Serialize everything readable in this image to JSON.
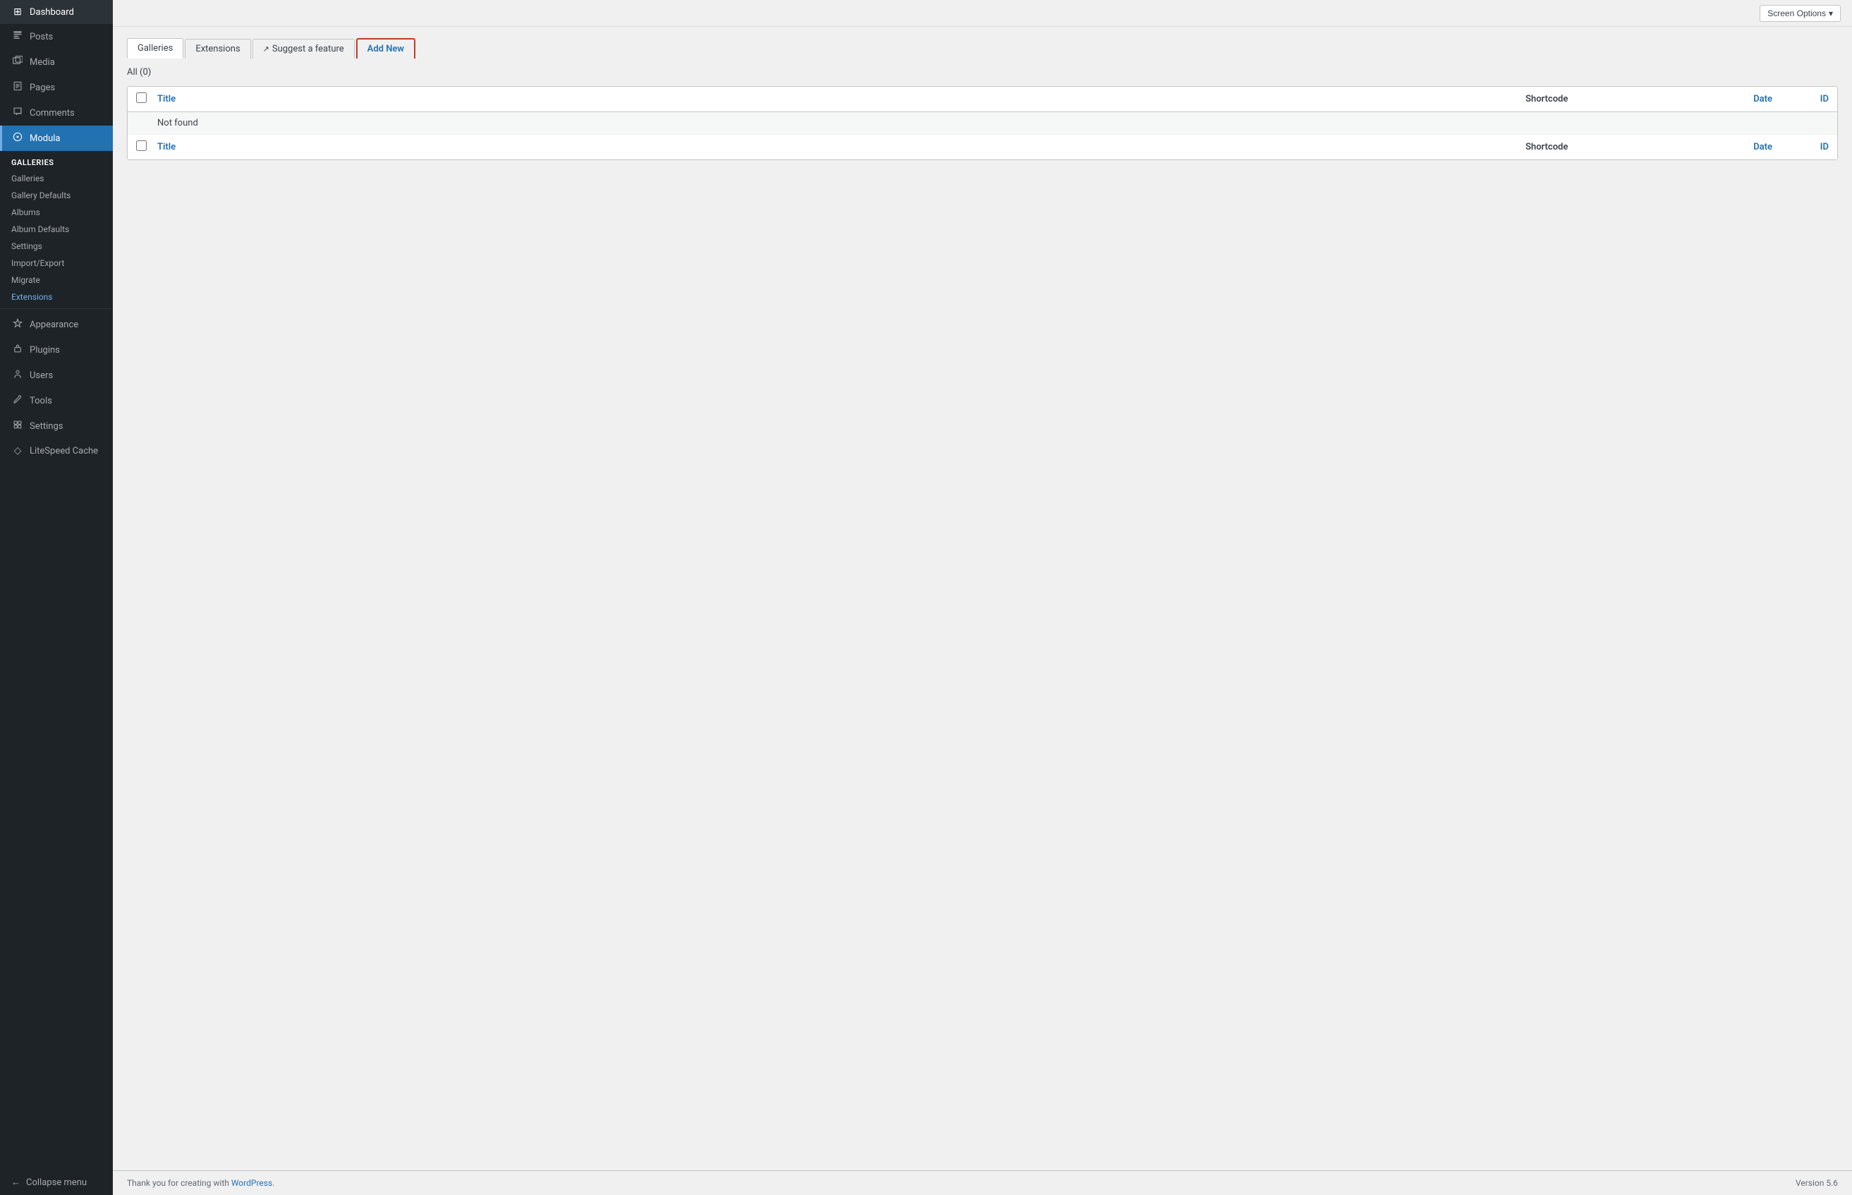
{
  "sidebar": {
    "items": [
      {
        "id": "dashboard",
        "label": "Dashboard",
        "icon": "⊞"
      },
      {
        "id": "posts",
        "label": "Posts",
        "icon": "📝"
      },
      {
        "id": "media",
        "label": "Media",
        "icon": "🖼"
      },
      {
        "id": "pages",
        "label": "Pages",
        "icon": "📄"
      },
      {
        "id": "comments",
        "label": "Comments",
        "icon": "💬"
      },
      {
        "id": "modula",
        "label": "Modula",
        "icon": "⚙"
      }
    ],
    "modula_section": "Galleries",
    "modula_sub": [
      {
        "id": "galleries",
        "label": "Galleries",
        "active": true
      },
      {
        "id": "gallery-defaults",
        "label": "Gallery Defaults"
      },
      {
        "id": "albums",
        "label": "Albums"
      },
      {
        "id": "album-defaults",
        "label": "Album Defaults"
      },
      {
        "id": "settings",
        "label": "Settings"
      },
      {
        "id": "import-export",
        "label": "Import/Export"
      },
      {
        "id": "migrate",
        "label": "Migrate"
      },
      {
        "id": "extensions",
        "label": "Extensions",
        "highlight": true
      }
    ],
    "bottom_items": [
      {
        "id": "appearance",
        "label": "Appearance",
        "icon": "🎨"
      },
      {
        "id": "plugins",
        "label": "Plugins",
        "icon": "🔌"
      },
      {
        "id": "users",
        "label": "Users",
        "icon": "👤"
      },
      {
        "id": "tools",
        "label": "Tools",
        "icon": "🔧"
      },
      {
        "id": "settings",
        "label": "Settings",
        "icon": "⚙"
      },
      {
        "id": "litespeed-cache",
        "label": "LiteSpeed Cache",
        "icon": "◇"
      }
    ],
    "collapse_label": "Collapse menu"
  },
  "topbar": {
    "screen_options_label": "Screen Options",
    "screen_options_arrow": "▾"
  },
  "tabs": [
    {
      "id": "galleries",
      "label": "Galleries",
      "active": true
    },
    {
      "id": "extensions",
      "label": "Extensions"
    },
    {
      "id": "suggest",
      "label": "Suggest a feature",
      "external": true
    },
    {
      "id": "add-new",
      "label": "Add New",
      "highlight": true
    }
  ],
  "content": {
    "filter_label": "All",
    "filter_count": "(0)",
    "table": {
      "header": {
        "checkbox_label": "",
        "title_col": "Title",
        "shortcode_col": "Shortcode",
        "date_col": "Date",
        "id_col": "ID"
      },
      "body": [
        {
          "not_found": "Not found"
        }
      ],
      "footer": {
        "title_col": "Title",
        "shortcode_col": "Shortcode",
        "date_col": "Date",
        "id_col": "ID"
      }
    }
  },
  "footer": {
    "thank_you_text": "Thank you for creating with",
    "wordpress_link": "WordPress",
    "version_label": "Version 5.6"
  }
}
